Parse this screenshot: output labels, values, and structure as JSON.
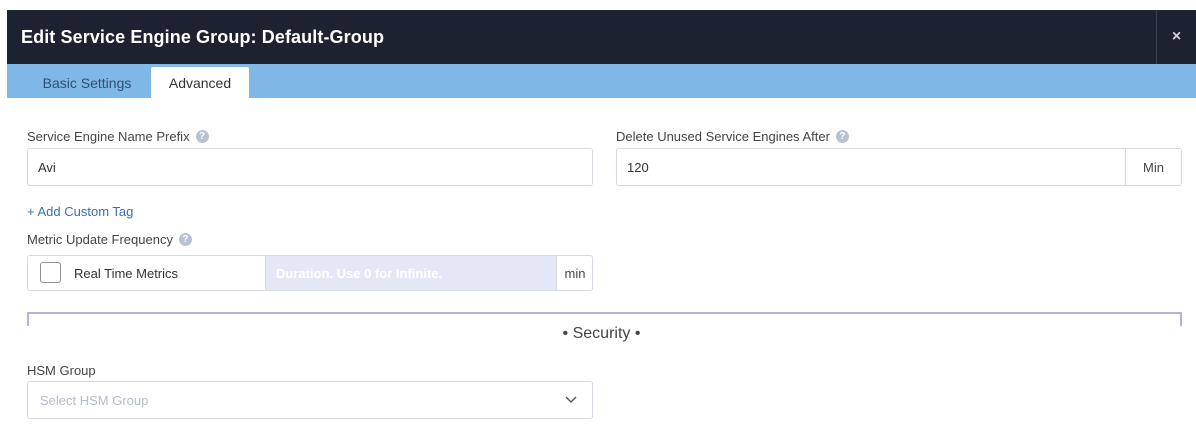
{
  "dialog": {
    "title": "Edit Service Engine Group: Default-Group",
    "close_label": "×"
  },
  "tabs": [
    {
      "label": "Basic Settings",
      "active": false
    },
    {
      "label": "Advanced",
      "active": true
    }
  ],
  "form": {
    "name_prefix": {
      "label": "Service Engine Name Prefix",
      "help": "?",
      "value": "Avi"
    },
    "delete_after": {
      "label": "Delete Unused Service Engines After",
      "help": "?",
      "value": "120",
      "unit": "Min"
    },
    "add_tag_link": "+ Add Custom Tag",
    "metric": {
      "label": "Metric Update Frequency",
      "help": "?",
      "checkbox_label": "Real Time Metrics",
      "checked": false,
      "duration_placeholder": "Duration. Use 0 for Infinite.",
      "unit": "min"
    },
    "security_header": "• Security •",
    "hsm": {
      "label": "HSM Group",
      "placeholder": "Select HSM Group"
    }
  },
  "colors": {
    "title_bg": "#1d2230",
    "tab_bar_bg": "#7fb8e6",
    "divider": "#b6b0dd",
    "disabled_input_bg": "#e4e8f6"
  }
}
